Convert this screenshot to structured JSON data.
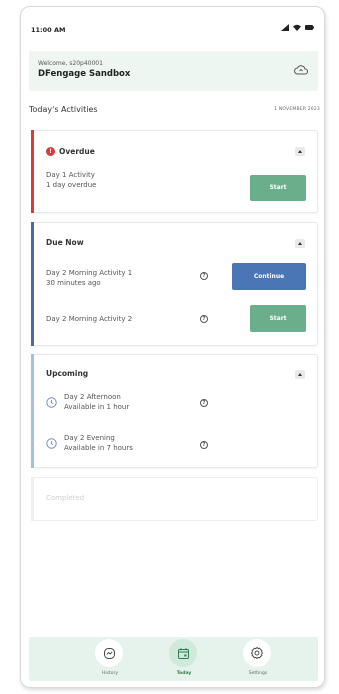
{
  "status_bar": {
    "time": "11:00 AM"
  },
  "welcome": {
    "greeting": "Welcome, s20p40001",
    "name": "DFengage Sandbox"
  },
  "section": {
    "title": "Today's Activities",
    "date": "1 NOVEMBER 2023"
  },
  "overdue": {
    "title": "Overdue",
    "activity_name": "Day 1 Activity",
    "activity_status": "1 day overdue",
    "button_label": "Start"
  },
  "due_now": {
    "title": "Due Now",
    "activities": [
      {
        "name": "Day 2 Morning Activity 1",
        "status": "30 minutes ago",
        "button_label": "Continue"
      },
      {
        "name": "Day 2 Morning Activity 2",
        "status": "",
        "button_label": "Start"
      }
    ]
  },
  "upcoming": {
    "title": "Upcoming",
    "activities": [
      {
        "name": "Day 2 Afternoon",
        "status": "Available in 1 hour"
      },
      {
        "name": "Day 2 Evening",
        "status": "Available in 7 hours"
      }
    ]
  },
  "completed": {
    "title": "Completed"
  },
  "tabs": [
    {
      "label": "History",
      "icon": "history-icon",
      "active": false
    },
    {
      "label": "Today",
      "icon": "calendar-icon",
      "active": true
    },
    {
      "label": "Settings",
      "icon": "gear-icon",
      "active": false
    }
  ],
  "colors": {
    "overdue_accent": "#d93a3a",
    "due_now_accent": "#4b6aa0",
    "upcoming_accent": "#a8bfdc",
    "start_button": "#6aae8b",
    "continue_button": "#4b76b5",
    "tabbar_bg": "#e6f3ec"
  }
}
